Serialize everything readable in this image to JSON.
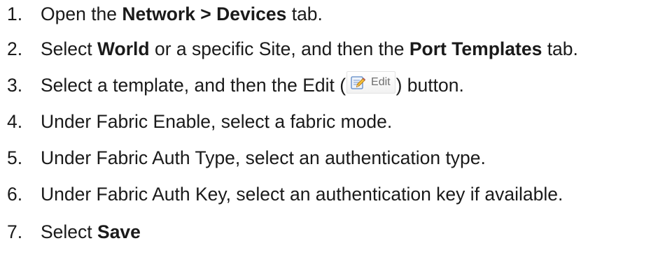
{
  "steps": [
    {
      "number": "1.",
      "parts": [
        "Open the ",
        "Network > Devices",
        " tab."
      ]
    },
    {
      "number": "2.",
      "parts": [
        "Select ",
        "World",
        " or a specific Site, and then the ",
        "Port Templates",
        " tab."
      ]
    },
    {
      "number": "3.",
      "parts": [
        "Select a template, and then the Edit (",
        ") button."
      ],
      "edit_button_label": "Edit",
      "edit_button_icon": "edit-pencil-icon"
    },
    {
      "number": "4.",
      "parts": [
        "Under Fabric Enable, select a fabric mode."
      ]
    },
    {
      "number": "5.",
      "parts": [
        "Under Fabric Auth Type, select an authentication type."
      ]
    },
    {
      "number": "6.",
      "parts": [
        "Under Fabric Auth Key, select an authentication key if available."
      ]
    },
    {
      "number": "7.",
      "parts": [
        "Select ",
        "Save"
      ]
    }
  ]
}
